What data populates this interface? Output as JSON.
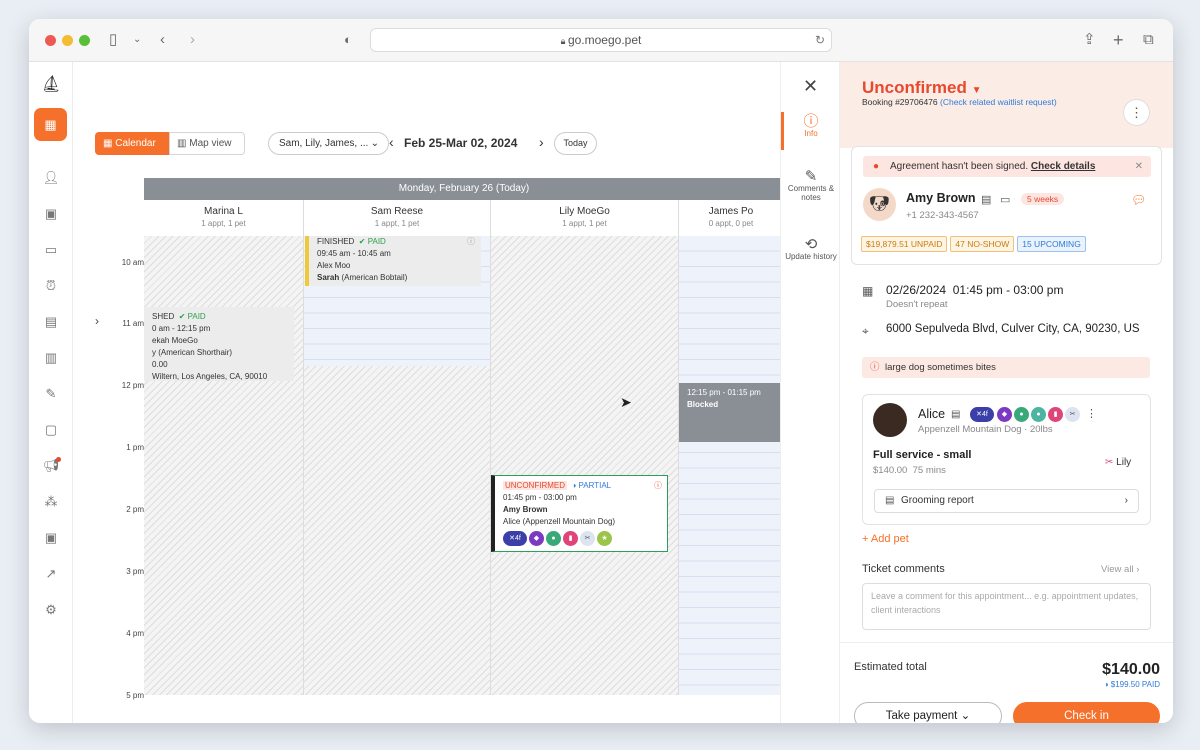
{
  "browser": {
    "url": "go.moego.pet"
  },
  "toolbar": {
    "calendar_label": "Calendar",
    "map_label": "Map view",
    "staff_filter": "Sam, Lily, James, ...",
    "date_range": "Feb 25-Mar 02, 2024",
    "today_label": "Today"
  },
  "calendar": {
    "day_header": "Monday, February 26 (Today)",
    "columns": [
      {
        "name": "Marina L",
        "sub": "1 appt, 1 pet"
      },
      {
        "name": "Sam Reese",
        "sub": "1 appt, 1 pet"
      },
      {
        "name": "Lily MoeGo",
        "sub": "1 appt, 1 pet"
      },
      {
        "name": "James Po",
        "sub": "0 appt, 0 pet"
      }
    ],
    "times": [
      "10 am",
      "11 am",
      "12 pm",
      "1 pm",
      "2 pm",
      "3 pm",
      "4 pm",
      "5 pm"
    ],
    "appt_marina": {
      "status": "SHED",
      "paid": "PAID",
      "time": "0 am - 12:15 pm",
      "client": "ekah MoeGo",
      "pet": "y (American Shorthair)",
      "price": "0.00",
      "address": "Wiltern, Los Angeles, CA, 90010"
    },
    "appt_sam": {
      "status": "FINISHED",
      "paid": "PAID",
      "time": "09:45 am - 10:45 am",
      "client": "Alex Moo",
      "pet_name": "Sarah",
      "pet_breed": "(American Bobtail)"
    },
    "appt_lily": {
      "status": "UNCONFIRMED",
      "paid": "PARTIAL",
      "time": "01:45 pm - 03:00 pm",
      "client": "Amy Brown",
      "pet": "Alice (Appenzell Mountain Dog)",
      "badge": "4f"
    },
    "blocked": {
      "time": "12:15 pm - 01:15 pm",
      "label": "Blocked"
    }
  },
  "panel_nav": [
    {
      "label": "Info",
      "icon": "info-icon"
    },
    {
      "label": "Comments & notes",
      "icon": "comments-icon"
    },
    {
      "label": "Update history",
      "icon": "history-icon"
    }
  ],
  "panel": {
    "status": "Unconfirmed",
    "booking": "Booking #29706476",
    "waitlist_link": "(Check related waitlist request)",
    "agreement": "Agreement hasn't been signed.",
    "agreement_link": "Check details",
    "client_name": "Amy Brown",
    "client_phone": "+1 232-343-4567",
    "frequency": "5 weeks",
    "tags": [
      "$19,879.51 UNPAID",
      "47 NO-SHOW",
      "15 UPCOMING"
    ],
    "datetime": "02/26/2024  01:45 pm - 03:00 pm",
    "repeat": "Doesn't repeat",
    "address": "6000 Sepulveda Blvd, Culver City, CA, 90230, US",
    "alert": "large dog sometimes bites",
    "pet_name": "Alice",
    "pet_breed": "Appenzell Mountain Dog · 20lbs",
    "pet_badge": "4f",
    "service": "Full service - small",
    "service_price": "$140.00",
    "service_duration": "75 mins",
    "staff": "Lily",
    "grooming_report": "Grooming report",
    "add_pet": "+ Add pet",
    "ticket_comments": "Ticket comments",
    "view_all": "View all",
    "comment_placeholder": "Leave a comment for this appointment... e.g. appointment updates, client interactions",
    "estimated_label": "Estimated total",
    "total": "$140.00",
    "paid": "$199.50 PAID",
    "take_payment": "Take payment",
    "check_in": "Check in"
  },
  "colors": {
    "accent": "#f5702a",
    "status": "#e8492e",
    "link": "#2f7bd8"
  }
}
